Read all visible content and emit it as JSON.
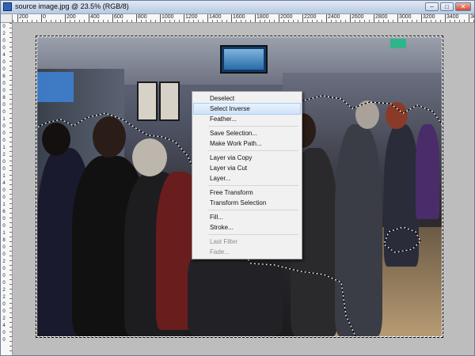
{
  "window": {
    "title": "source image.jpg @ 23.5% (RGB/8)",
    "controls": {
      "minimize": "–",
      "maximize": "□",
      "close": "✕"
    }
  },
  "rulers": {
    "horizontal": [
      "200",
      "0",
      "200",
      "400",
      "600",
      "800",
      "1000",
      "1200",
      "1400",
      "1600",
      "1800",
      "2000",
      "2200",
      "2400",
      "2600",
      "2800",
      "3000",
      "3200",
      "3400",
      "3600"
    ],
    "vertical": [
      "0",
      "2",
      "0",
      "0",
      "4",
      "0",
      "0",
      "6",
      "0",
      "0",
      "8",
      "0",
      "0",
      "1",
      "0",
      "0",
      "0",
      "1",
      "2",
      "0",
      "0",
      "1",
      "4",
      "0",
      "0",
      "1",
      "6",
      "0",
      "0",
      "1",
      "8",
      "0",
      "0",
      "2",
      "0",
      "0",
      "0",
      "2",
      "2",
      "0",
      "0",
      "2",
      "4",
      "0",
      "0"
    ]
  },
  "context_menu": {
    "groups": [
      [
        {
          "label": "Deselect",
          "state": "normal"
        },
        {
          "label": "Select Inverse",
          "state": "active"
        },
        {
          "label": "Feather...",
          "state": "normal"
        }
      ],
      [
        {
          "label": "Save Selection...",
          "state": "normal"
        },
        {
          "label": "Make Work Path...",
          "state": "normal"
        }
      ],
      [
        {
          "label": "Layer via Copy",
          "state": "normal"
        },
        {
          "label": "Layer via Cut",
          "state": "normal"
        },
        {
          "label": "Layer...",
          "state": "normal"
        }
      ],
      [
        {
          "label": "Free Transform",
          "state": "normal"
        },
        {
          "label": "Transform Selection",
          "state": "normal"
        }
      ],
      [
        {
          "label": "Fill...",
          "state": "normal"
        },
        {
          "label": "Stroke...",
          "state": "normal"
        }
      ],
      [
        {
          "label": "Last Filter",
          "state": "disabled"
        },
        {
          "label": "Fade...",
          "state": "disabled"
        }
      ]
    ]
  },
  "colors": {
    "titlebar": "#c5d4ea",
    "canvas_background": "#bdbdbd",
    "menu_highlight": "#cfe2fa"
  },
  "icons": [
    "photoshop-app-icon",
    "minimize-icon",
    "maximize-icon",
    "close-icon"
  ]
}
